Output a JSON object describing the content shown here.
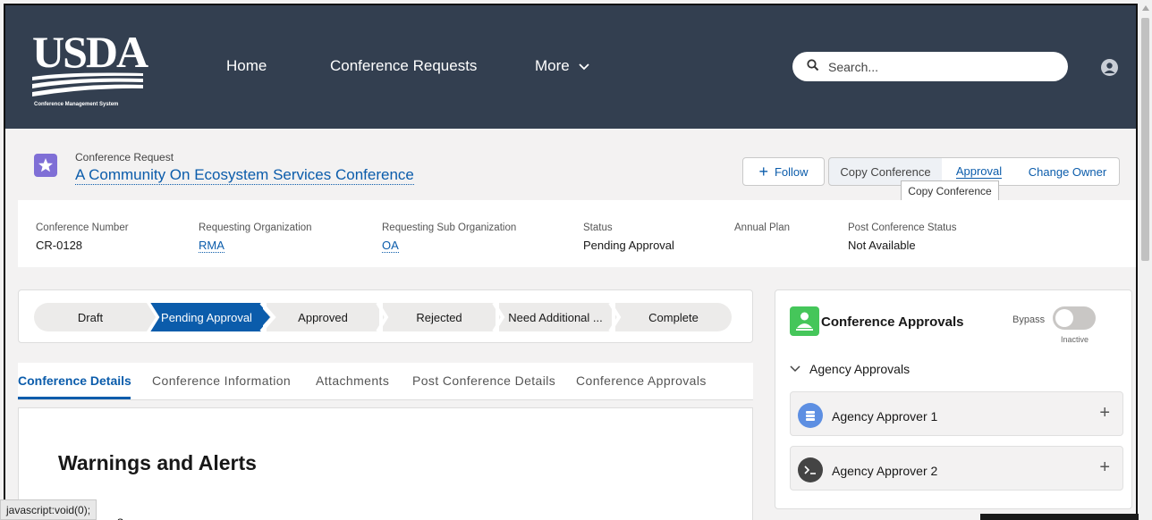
{
  "header": {
    "logo_text": "USDA",
    "logo_caption": "Conference Management System",
    "nav": {
      "home": "Home",
      "conference_requests": "Conference Requests",
      "more": "More"
    },
    "search": {
      "placeholder": "Search..."
    }
  },
  "record": {
    "object_type": "Conference Request",
    "title": "A Community On Ecosystem Services Conference",
    "actions": {
      "follow": "Follow",
      "copy_conference": "Copy Conference",
      "approval": "Approval",
      "change_owner": "Change Owner"
    },
    "tooltip": "Copy Conference",
    "fields": [
      {
        "label": "Conference Number",
        "value": "CR-0128"
      },
      {
        "label": "Requesting Organization",
        "value": "RMA"
      },
      {
        "label": "Requesting Sub Organization",
        "value": "OA"
      },
      {
        "label": "Status",
        "value": "Pending Approval"
      },
      {
        "label": "Annual Plan",
        "value": ""
      },
      {
        "label": "Post Conference Status",
        "value": "Not Available"
      }
    ]
  },
  "path": {
    "steps": [
      "Draft",
      "Pending Approval",
      "Approved",
      "Rejected",
      "Need Additional ...",
      "Complete"
    ],
    "active": "Pending Approval"
  },
  "tabs": [
    "Conference Details",
    "Conference Information",
    "Attachments",
    "Post Conference Details",
    "Conference Approvals"
  ],
  "active_tab": "Conference Details",
  "content": {
    "warnings_title": "Warnings and Alerts",
    "partial_text": "s"
  },
  "approvals": {
    "title": "Conference Approvals",
    "bypass_label": "Bypass",
    "bypass_state": "Inactive",
    "section": "Agency Approvals",
    "approvers": [
      "Agency Approver 1",
      "Agency Approver 2"
    ]
  },
  "status_bar": "javascript:void(0);",
  "colors": {
    "header_bg": "#333f50",
    "accent": "#0b5cab",
    "record_icon": "#7f6fd6",
    "approvals_icon": "#45c65a"
  }
}
